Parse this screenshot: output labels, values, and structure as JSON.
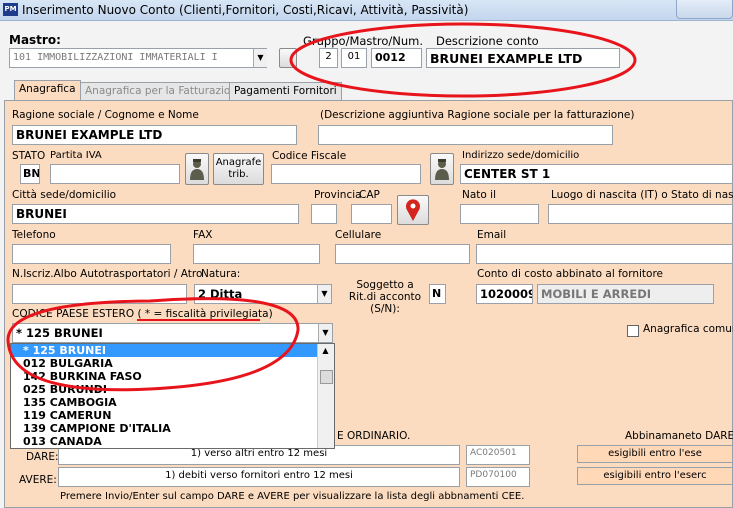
{
  "window": {
    "app_icon": "PM",
    "title": "Inserimento Nuovo Conto (Clienti,Fornitori, Costi,Ricavi, Attività, Passività)"
  },
  "mastro": {
    "label": "Mastro:",
    "value": "101 IMMOBILIZZAZIONI IMMATERIALI I"
  },
  "gruppo": {
    "label": "Gruppo/Mastro/Num.",
    "g": "2",
    "m": "01",
    "n": "0012"
  },
  "descrizione": {
    "label": "Descrizione conto",
    "value": "BRUNEI EXAMPLE LTD"
  },
  "tabs": [
    {
      "label": "Anagrafica"
    },
    {
      "label": "Anagrafica per la Fatturazione"
    },
    {
      "label": "Pagamenti Fornitori"
    }
  ],
  "form": {
    "ragione_label": "Ragione sociale / Cognome e Nome",
    "ragione_value": "BRUNEI EXAMPLE LTD",
    "desc_agg_label": "(Descrizione aggiuntiva  Ragione sociale per la fatturazione)",
    "stato_label": "STATO",
    "piva_label": "Partita IVA",
    "stato_value": "BN",
    "anagrafe_btn": "Anagrafe trib.",
    "cf_label": "Codice Fiscale",
    "indirizzo_label": "Indirizzo sede/domicilio",
    "indirizzo_value": "CENTER ST 1",
    "citta_label": "Città sede/domicilio",
    "citta_value": "BRUNEI",
    "provincia_label": "Provincia",
    "cap_label": "CAP",
    "nato_label": "Nato il",
    "luogo_label": "Luogo di nascita (IT) o Stato di nascita",
    "telefono_label": "Telefono",
    "fax_label": "FAX",
    "cellulare_label": "Cellulare",
    "email_label": "Email",
    "albo_label": "N.Iscriz.Albo Autotrasportatori / Atro",
    "natura_label": "Natura:",
    "natura_value": "2 Ditta",
    "soggetto_label": "Soggetto a Rit.di acconto (S/N):",
    "soggetto_value": "N",
    "conto_costo_label": "Conto di costo abbinato al fornitore",
    "conto_costo_code": "1020009",
    "conto_costo_desc": "MOBILI E ARREDI",
    "paese_label": "CODICE PAESE ESTERO (",
    "paese_note": "* = fiscalità privilegiata)",
    "paese_value": "* 125 BRUNEI",
    "anagrafica_comune_label": "Anagrafica comune"
  },
  "country_list": [
    "* 125 BRUNEI",
    "012 BULGARIA",
    "142 BURKINA FASO",
    "025 BURUNDI",
    "135 CAMBOGIA",
    "119 CAMERUN",
    "139 CAMPIONE D'ITALIA",
    "013 CANADA"
  ],
  "cee": {
    "header_left": "E ORDINARIO.",
    "header_right": "Abbinamaneto DARE/A",
    "dare_label": "DARE:",
    "dare_value": "1) verso altri entro 12 mesi",
    "dare_code": "AC020501",
    "dare_right": "esigibili entro l'ese",
    "avere_label": "AVERE:",
    "avere_value": "1) debiti verso fornitori entro 12 mesi",
    "avere_code": "PD070100",
    "avere_right": "esigibili entro l'eserc",
    "hint": "Premere Invio/Enter sul campo DARE e AVERE per visualizzare la lista degli abbnamenti CEE."
  },
  "colors": {
    "panel": "#fcdcc0",
    "selection": "#3399ff",
    "annotation": "#e8141c"
  }
}
